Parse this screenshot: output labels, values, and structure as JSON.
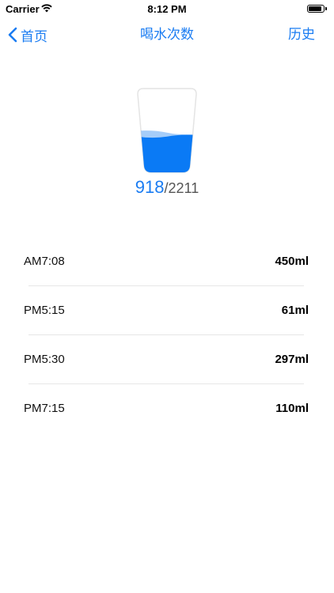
{
  "status_bar": {
    "carrier": "Carrier",
    "time": "8:12 PM",
    "battery_level": 0.9
  },
  "nav": {
    "back_label": "首页",
    "title": "喝水次数",
    "right_label": "历史"
  },
  "intake": {
    "current": "918",
    "separator": "/",
    "goal": "2211",
    "fill_fraction": 0.415
  },
  "records": [
    {
      "time": "AM7:08",
      "amount": "450ml"
    },
    {
      "time": "PM5:15",
      "amount": "61ml"
    },
    {
      "time": "PM5:30",
      "amount": "297ml"
    },
    {
      "time": "PM7:15",
      "amount": "110ml"
    }
  ],
  "colors": {
    "accent": "#1a7cf2",
    "water": "#0a7af5"
  }
}
